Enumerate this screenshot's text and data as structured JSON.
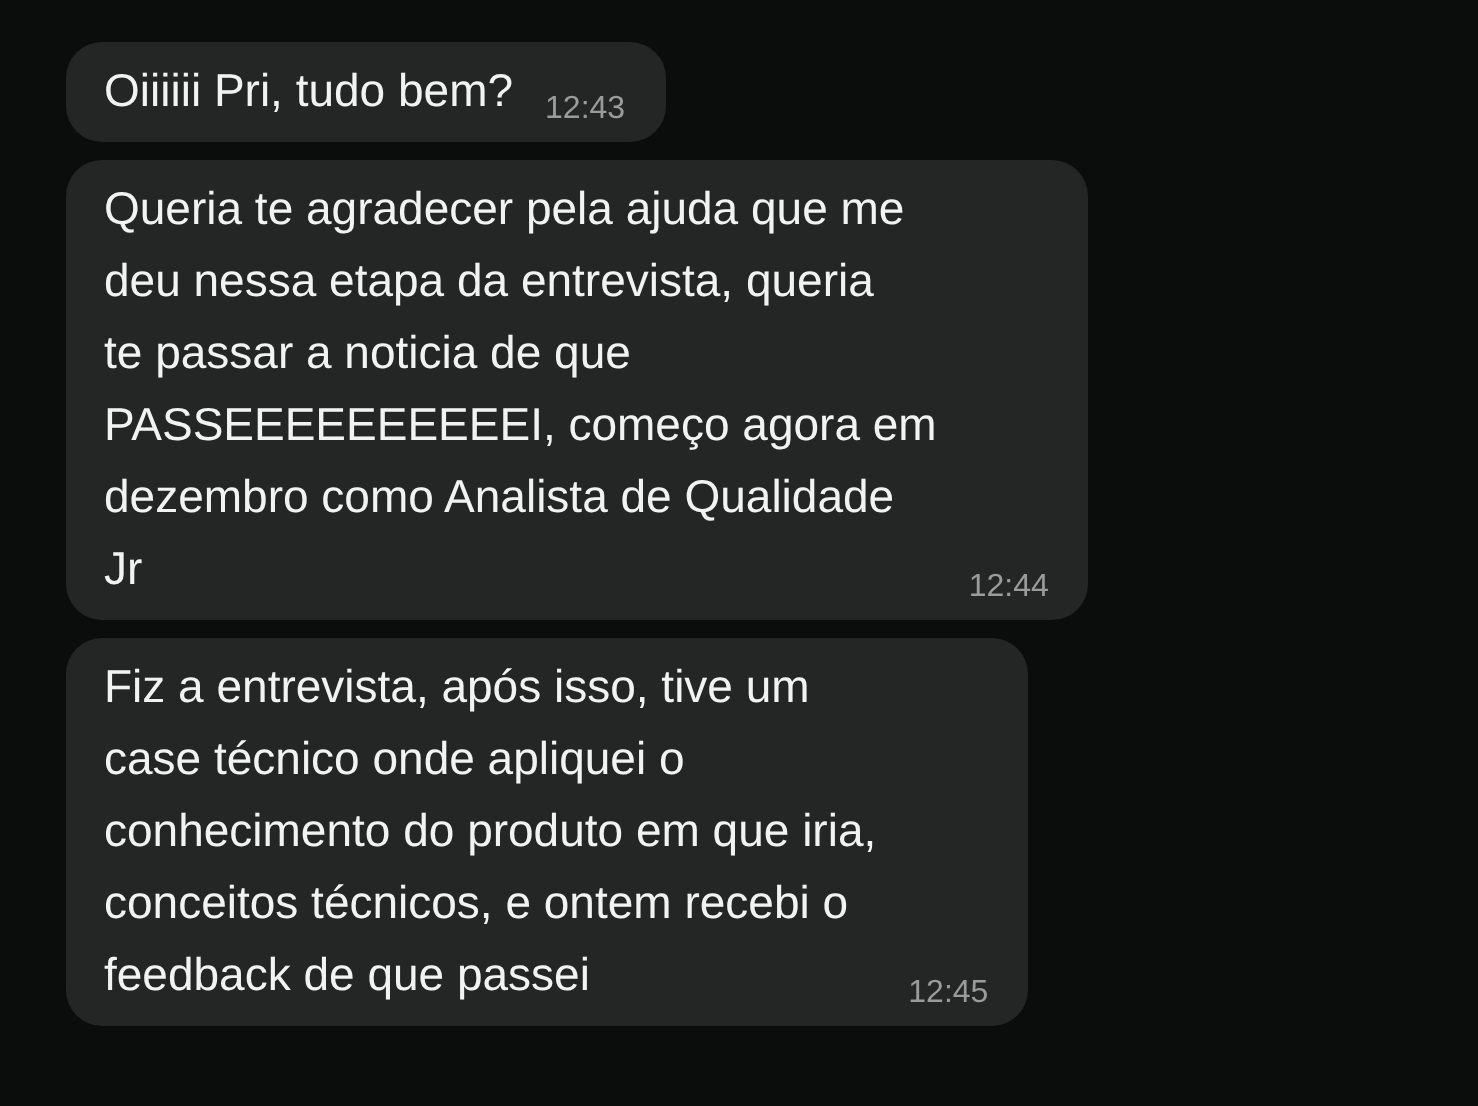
{
  "messages": [
    {
      "text": "Oiiiiii Pri, tudo bem?",
      "time": "12:43"
    },
    {
      "text": "Queria te agradecer pela ajuda que me\ndeu nessa etapa da entrevista, queria\nte passar a noticia de que\nPASSEEEEEEEEEEI, começo agora em\ndezembro como Analista de Qualidade\nJr",
      "time": "12:44"
    },
    {
      "text": "Fiz a entrevista, após isso, tive um\ncase técnico onde apliquei o\nconhecimento do produto em que iria,\nconceitos técnicos, e ontem recebi o\nfeedback de que passei",
      "time": "12:45"
    }
  ]
}
